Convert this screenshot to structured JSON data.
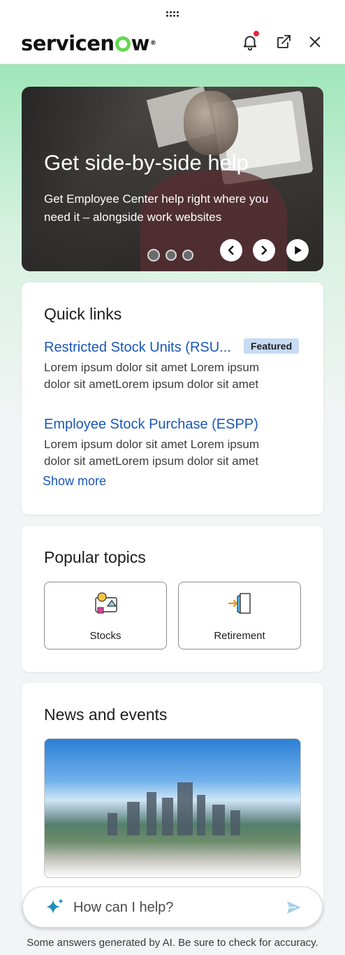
{
  "header": {
    "logo_text_a": "servicen",
    "logo_text_b": "w",
    "logo_tm": "®"
  },
  "hero": {
    "title": "Get side-by-side help",
    "subtitle": "Get Employee Center help right where you need it – alongside work websites",
    "slide_count": 3,
    "active_slide": 1
  },
  "quick_links": {
    "heading": "Quick links",
    "items": [
      {
        "title": "Restricted Stock Units (RSU...",
        "badge": "Featured",
        "description": "Lorem ipsum dolor sit amet Lorem ipsum dolor sit ametLorem ipsum dolor sit amet"
      },
      {
        "title": "Employee Stock Purchase (ESPP)",
        "description": "Lorem ipsum dolor sit amet Lorem ipsum dolor sit ametLorem ipsum dolor sit amet"
      }
    ],
    "show_more": "Show more"
  },
  "popular_topics": {
    "heading": "Popular topics",
    "items": [
      {
        "label": "Stocks",
        "icon": "stocks-icon"
      },
      {
        "label": "Retirement",
        "icon": "retirement-door-icon"
      }
    ]
  },
  "news": {
    "heading": "News and events"
  },
  "assistant": {
    "placeholder": "How can I help?",
    "disclaimer": "Some answers generated by AI. Be sure to check for accuracy."
  },
  "colors": {
    "link": "#1a56b8",
    "badge_bg": "#c7dbf4",
    "brand_green": "#62d84e",
    "notification": "#e5243b"
  }
}
